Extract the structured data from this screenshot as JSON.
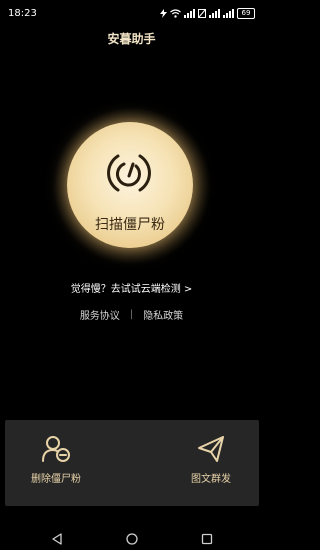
{
  "status_bar": {
    "time": "18:23",
    "battery_level": "69",
    "icons": [
      "flash-icon",
      "wifi-icon",
      "signal-icon",
      "no-sim-icon",
      "signal-icon",
      "signal-icon",
      "battery-icon"
    ]
  },
  "header": {
    "title": "安暮助手"
  },
  "scan": {
    "label": "扫描僵尸粉",
    "icon": "scan-radar-icon"
  },
  "cloud_detect": {
    "text": "觉得慢？去试试云端检测 >"
  },
  "policies": {
    "service_agreement": "服务协议",
    "separator": "|",
    "privacy_policy": "隐私政策"
  },
  "actions": {
    "delete_zombie_fans": {
      "label": "删除僵尸粉",
      "icon": "remove-user-icon"
    },
    "mass_send": {
      "label": "图文群发",
      "icon": "send-icon"
    }
  },
  "nav": {
    "back": "back-icon",
    "home": "home-icon",
    "recent": "recent-apps-icon"
  },
  "colors": {
    "background": "#000000",
    "accent_gold": "#e8d3a8",
    "panel": "#262626"
  }
}
